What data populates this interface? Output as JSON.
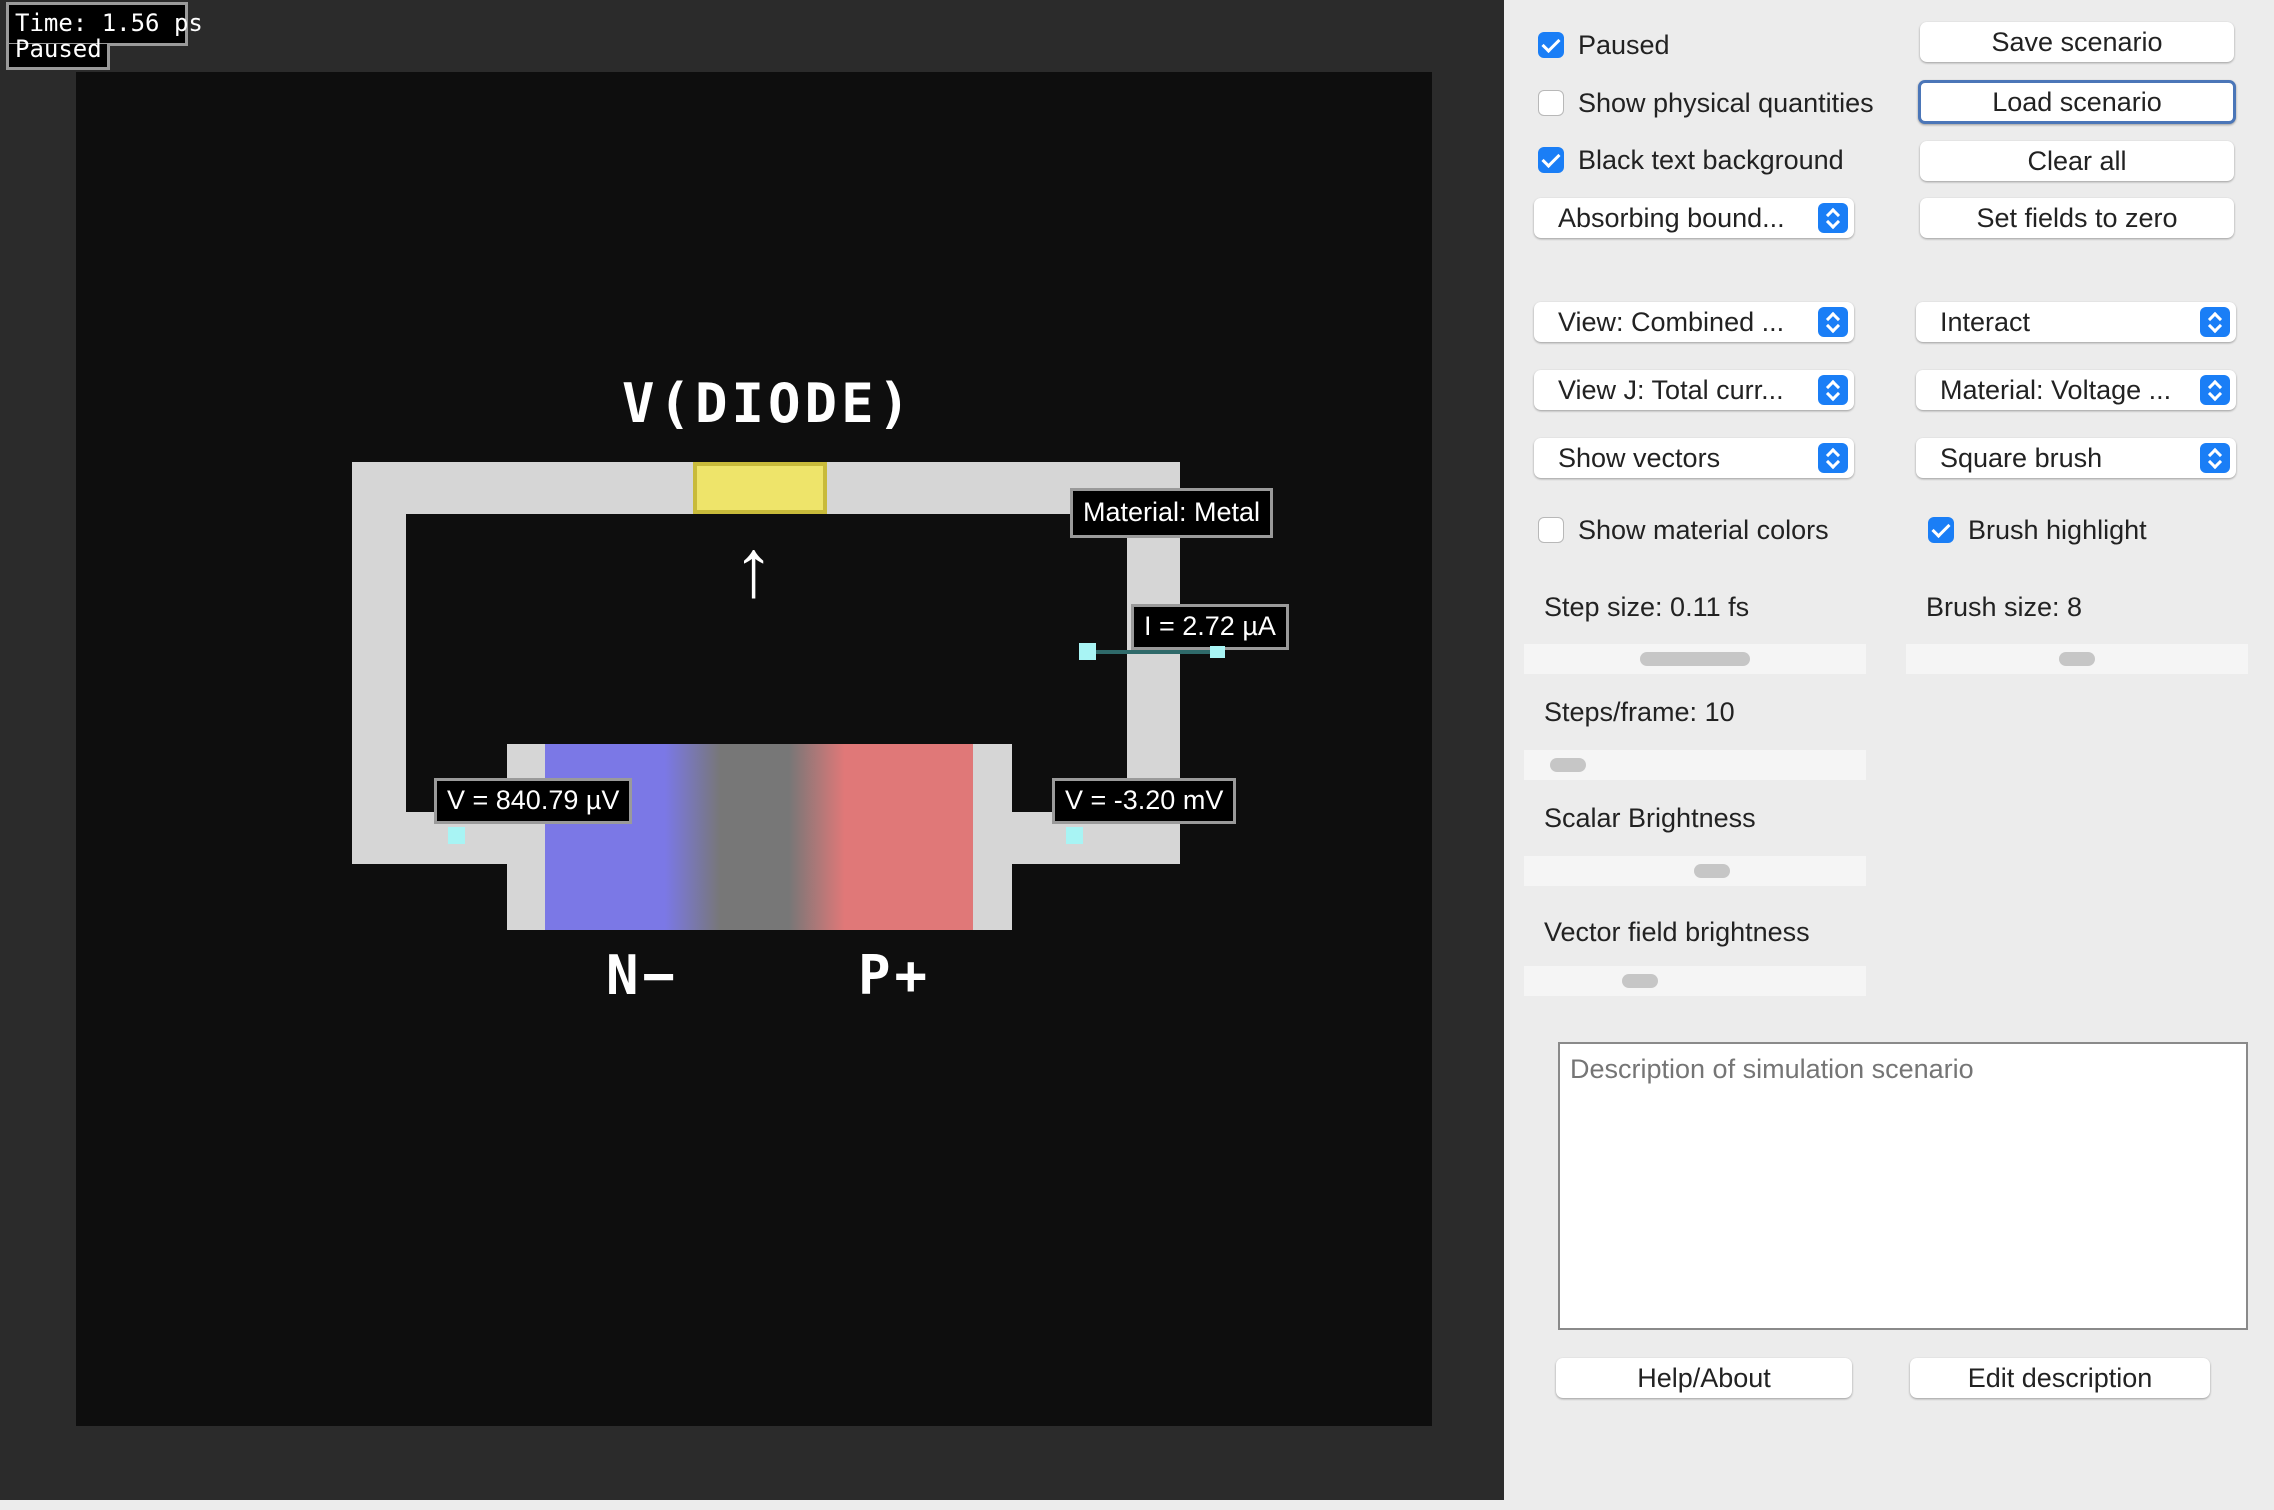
{
  "status": {
    "time": "Time: 1.56 ps",
    "state": "Paused"
  },
  "canvas": {
    "diode_title": "V(DIODE)",
    "material_label": "Material: Metal",
    "current_label": "I = 2.72 µA",
    "voltage_left": "V = 840.79 µV",
    "voltage_right": "V = -3.20 mV",
    "n_label": "N−",
    "p_label": "P+",
    "arrow_glyph": "↑",
    "colors": {
      "n_region": "#7b78e6",
      "p_region": "#e07878",
      "source": "#eee46a",
      "wire": "#d6d6d6",
      "probe": "#a8f4f4"
    }
  },
  "controls": {
    "paused": {
      "label": "Paused",
      "checked": true
    },
    "show_physical": {
      "label": "Show physical quantities",
      "checked": false
    },
    "black_text_bg": {
      "label": "Black text background",
      "checked": true
    },
    "boundary_select": "Absorbing bound...",
    "save_scenario": "Save scenario",
    "load_scenario": "Load scenario",
    "clear_all": "Clear all",
    "set_fields_zero": "Set fields to zero",
    "view_select": "View: Combined ...",
    "interact_select": "Interact",
    "viewj_select": "View J: Total curr...",
    "material_select": "Material: Voltage ...",
    "vectors_select": "Show vectors",
    "brush_select": "Square brush",
    "show_material_colors": {
      "label": "Show material colors",
      "checked": false
    },
    "brush_highlight": {
      "label": "Brush highlight",
      "checked": true
    },
    "step_size": {
      "label": "Step size: 0.11 fs",
      "value": 0.5
    },
    "brush_size": {
      "label": "Brush size: 8",
      "value": 0.5
    },
    "steps_per_frame": {
      "label": "Steps/frame: 10",
      "value": 0.13
    },
    "scalar_brightness": {
      "label": "Scalar Brightness",
      "value": 0.55
    },
    "vector_brightness": {
      "label": "Vector field brightness",
      "value": 0.34
    },
    "description_placeholder": "Description of simulation scenario",
    "help_about": "Help/About",
    "edit_description": "Edit description"
  }
}
